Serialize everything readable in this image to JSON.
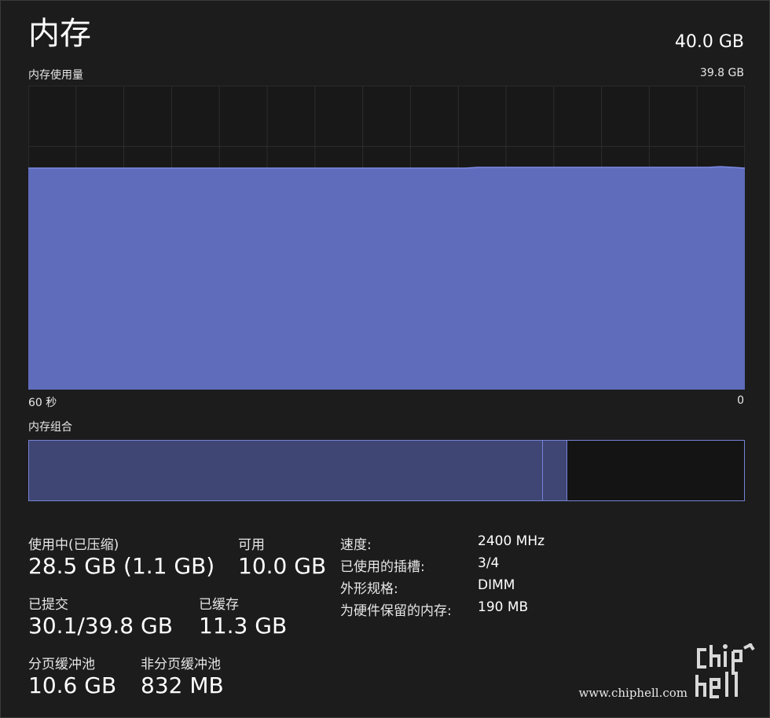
{
  "header": {
    "title": "内存",
    "total_capacity": "40.0 GB"
  },
  "usage_chart": {
    "label": "内存使用量",
    "max_label": "39.8 GB",
    "x_left_label": "60 秒",
    "x_right_label": "0"
  },
  "composition": {
    "label": "内存组合"
  },
  "stats": {
    "in_use_label": "使用中(已压缩)",
    "in_use_value": "28.5 GB (1.1 GB)",
    "available_label": "可用",
    "available_value": "10.0 GB",
    "committed_label": "已提交",
    "committed_value": "30.1/39.8 GB",
    "cached_label": "已缓存",
    "cached_value": "11.3 GB",
    "paged_pool_label": "分页缓冲池",
    "paged_pool_value": "10.6 GB",
    "nonpaged_pool_label": "非分页缓冲池",
    "nonpaged_pool_value": "832 MB"
  },
  "specs": {
    "speed_key": "速度:",
    "speed_val": "2400 MHz",
    "slots_key": "已使用的插槽:",
    "slots_val": "3/4",
    "form_key": "外形规格:",
    "form_val": "DIMM",
    "reserved_key": "为硬件保留的内存:",
    "reserved_val": "190 MB"
  },
  "watermark": {
    "brand": "chiphell",
    "url": "www.chiphell.com"
  },
  "chart_data": {
    "type": "area",
    "x_range_seconds": [
      60,
      0
    ],
    "ylim_gb": [
      0,
      39.8
    ],
    "series": [
      {
        "values_gb": [
          29.0,
          29.0,
          29.0,
          29.0,
          29.0,
          29.0,
          29.0,
          29.0,
          29.0,
          29.0,
          29.0,
          29.0,
          29.0,
          29.0,
          29.0,
          29.0,
          29.0,
          29.0,
          29.0,
          29.0,
          29.0,
          29.0,
          29.0,
          29.0,
          29.0,
          29.0,
          29.0,
          29.0,
          29.0,
          29.0,
          29.0,
          29.0,
          29.0,
          29.0,
          29.0,
          29.0,
          29.0,
          29.1,
          29.1,
          29.1,
          29.1,
          29.1,
          29.1,
          29.1,
          29.1,
          29.1,
          29.1,
          29.1,
          29.1,
          29.1,
          29.1,
          29.1,
          29.1,
          29.1,
          29.1,
          29.1,
          29.1,
          29.2,
          29.1,
          29.0
        ]
      }
    ],
    "composition_fractions": {
      "in_use": 0.718,
      "modified": 0.033,
      "free": 0.249
    },
    "colors": {
      "fill": "#5f6bbb",
      "line": "#7d8ae3",
      "grid": "#2c2c2c",
      "border": "#3a3a3a"
    },
    "grid": true
  }
}
